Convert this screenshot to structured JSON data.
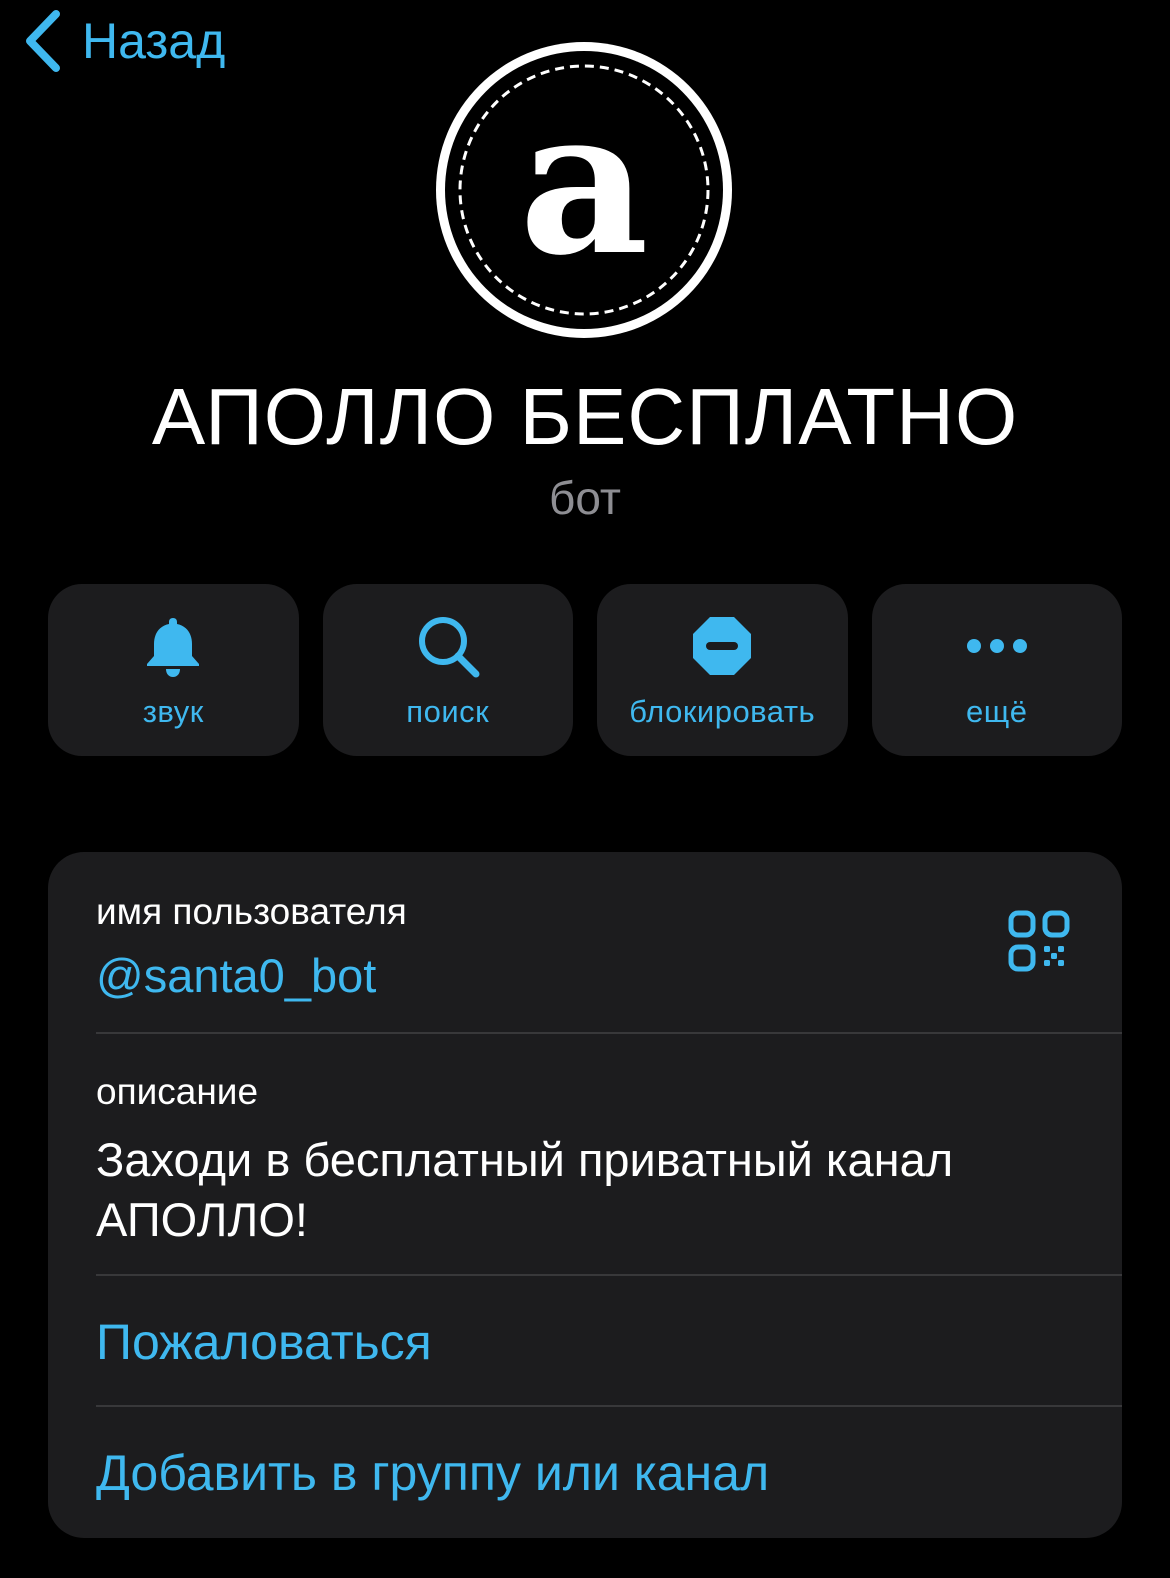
{
  "nav": {
    "back_label": "Назад",
    "back_icon": "chevron-left-icon"
  },
  "profile": {
    "avatar_letter": "a",
    "title": "АПОЛЛО БЕСПЛАТНО",
    "subtitle": "бот"
  },
  "actions": [
    {
      "label": "звук",
      "icon": "bell-icon"
    },
    {
      "label": "поиск",
      "icon": "search-icon"
    },
    {
      "label": "блокировать",
      "icon": "block-icon"
    },
    {
      "label": "ещё",
      "icon": "more-icon"
    }
  ],
  "info": {
    "username_label": "имя пользователя",
    "username_value": "@santa0_bot",
    "qr_icon": "qr-code-icon",
    "description_label": "описание",
    "description_value": "Заходи в бесплатный приватный канал АПОЛЛО!",
    "report_label": "Пожаловаться",
    "add_label": "Добавить в группу или канал"
  },
  "colors": {
    "accent": "#3fb8ef",
    "background": "#000000",
    "card": "#1c1c1e",
    "secondary_text": "#8e8e93",
    "separator": "#38383a"
  }
}
